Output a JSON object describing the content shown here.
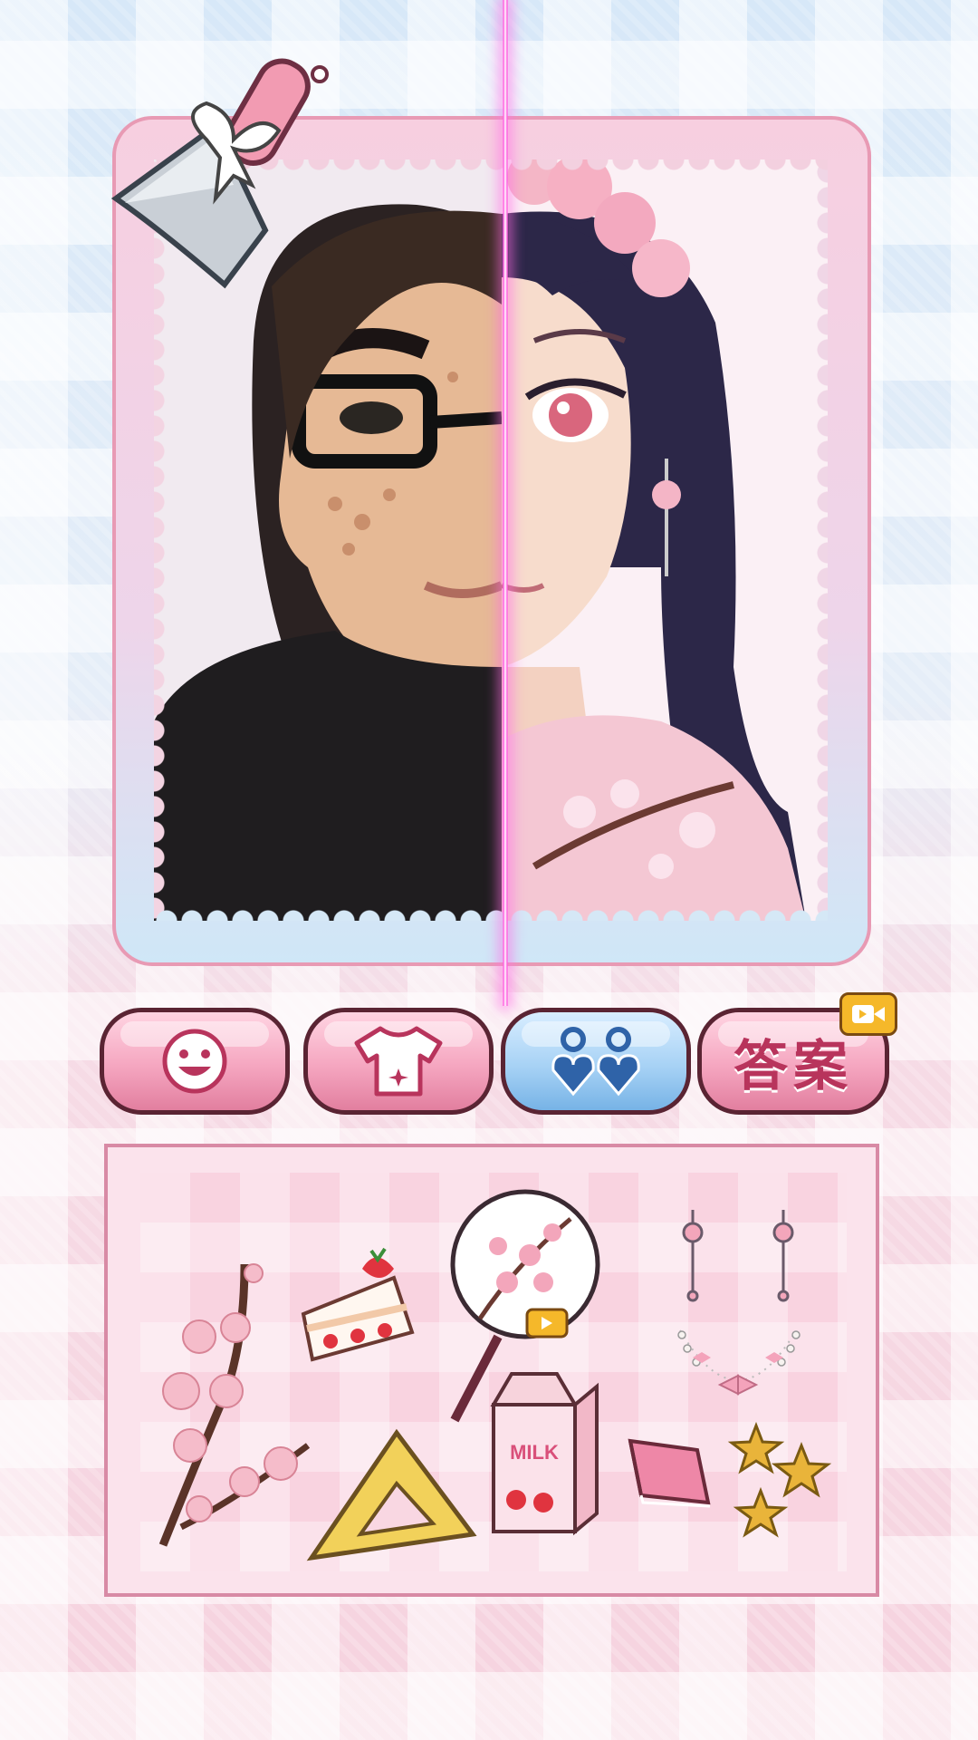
{
  "toolbar": {
    "tabs": [
      {
        "id": "face",
        "icon": "smiley-face-icon",
        "label": ""
      },
      {
        "id": "clothes",
        "icon": "tshirt-icon",
        "label": ""
      },
      {
        "id": "accessories",
        "icon": "heart-earrings-icon",
        "label": "",
        "selected": true
      },
      {
        "id": "answer",
        "icon": "video-ad-icon",
        "label": "答案"
      }
    ]
  },
  "items": [
    {
      "name": "cherry-blossom-branch",
      "icon": "blossom-branch-icon"
    },
    {
      "name": "strawberry-cake",
      "icon": "cake-slice-icon"
    },
    {
      "name": "blossom-hand-fan",
      "icon": "round-fan-icon",
      "locked_by_video": true
    },
    {
      "name": "blossom-earrings",
      "icon": "earrings-icon"
    },
    {
      "name": "pearl-bow-necklace",
      "icon": "necklace-icon"
    },
    {
      "name": "triangle-ruler",
      "icon": "set-square-icon"
    },
    {
      "name": "strawberry-milk-carton",
      "icon": "milk-carton-icon",
      "text": "MILK"
    },
    {
      "name": "pink-book",
      "icon": "book-icon"
    },
    {
      "name": "gold-stars",
      "icon": "star-icon"
    }
  ],
  "colors": {
    "pink_button": "#f5a6c0",
    "blue_button": "#a7d2f5",
    "label_red": "#b8345c",
    "divider": "#ff5fe0"
  }
}
